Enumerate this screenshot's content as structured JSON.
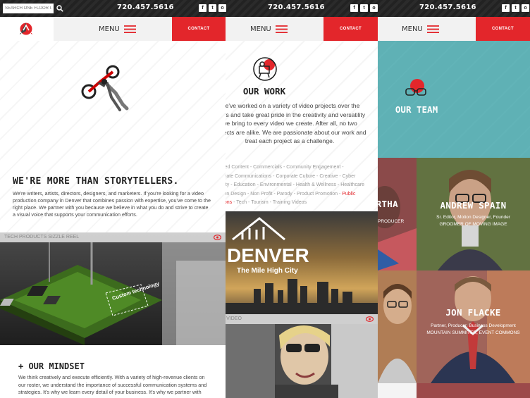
{
  "topbar": {
    "search_placeholder": "SEARCH ONE FLOOR UP",
    "phone": "720.457.5616",
    "socials": [
      "f",
      "t",
      "o"
    ]
  },
  "nav": {
    "menu_label": "MENU",
    "contact_label": "CONTACT"
  },
  "panel1": {
    "title": "WE'RE MORE THAN STORYTELLERS.",
    "body": "We're writers, artists, directors, designers, and marketers. If you're looking for a video production company in Denver that combines passion with expertise, you've come to the right place. We partner with you because we believe in what you do and strive to create a visual voice that supports your communication efforts.",
    "video_label": "TECH PRODUCTS SIZZLE REEL",
    "video_overlay": "Custom technology",
    "mindset_title": "+ OUR MINDSET",
    "mindset_body": "We think creatively and execute efficiently. With a variety of high-revenue clients on our roster, we understand the importance of successful communication systems and strategies. It's why we learn every detail of your business. It's why we partner with you"
  },
  "panel2": {
    "title": "OUR WORK",
    "body": "We've worked on a variety of video projects over the years and take great pride in the creativity and versatility we bring to every video we create. After all, no two projects are alike. We are passionate about our work and treat each project as a challenge.",
    "categories": [
      {
        "text": "Branded Content",
        "red": false
      },
      {
        "text": "Commercials",
        "red": false
      },
      {
        "text": "Community Engagement",
        "red": false
      },
      {
        "text": "Corporate Communications",
        "red": false
      },
      {
        "text": "Corporate Culture",
        "red": false
      },
      {
        "text": "Creative",
        "red": false
      },
      {
        "text": "Cyber Security",
        "red": false
      },
      {
        "text": "Education",
        "red": false
      },
      {
        "text": "Environmental",
        "red": false
      },
      {
        "text": "Health & Wellness",
        "red": false
      },
      {
        "text": "Healthcare",
        "red": false
      },
      {
        "text": "Motion Design",
        "red": false
      },
      {
        "text": "Non Profit",
        "red": false
      },
      {
        "text": "Parody",
        "red": false
      },
      {
        "text": "Product Promotion",
        "red": false
      },
      {
        "text": "Public Relations",
        "red": true
      },
      {
        "text": "Tech",
        "red": false
      },
      {
        "text": "Tourism",
        "red": false
      },
      {
        "text": "Training Videos",
        "red": false
      }
    ],
    "denver_title": "DENVER",
    "denver_subtitle": "The Mile High City",
    "video_label": "DENVER VIDEO"
  },
  "panel3": {
    "title": "OUR TEAM",
    "people": [
      {
        "name": "ANDREW SPAIN",
        "role": "Sr. Editor, Motion Designer, Founder",
        "subrole": "GROOMER OF MOVING IMAGE"
      },
      {
        "name": "JON FLACKE",
        "role": "Partner, Producer, Business Development",
        "subrole": "MOUNTAIN SUMMITER, EVENT COMMONS"
      },
      {
        "name": "MARTHA",
        "role": "PRODUCER",
        "subrole": ""
      }
    ]
  },
  "colors": {
    "accent": "#e3262b",
    "teal": "#5fb1b5",
    "topbar": "#262626"
  }
}
